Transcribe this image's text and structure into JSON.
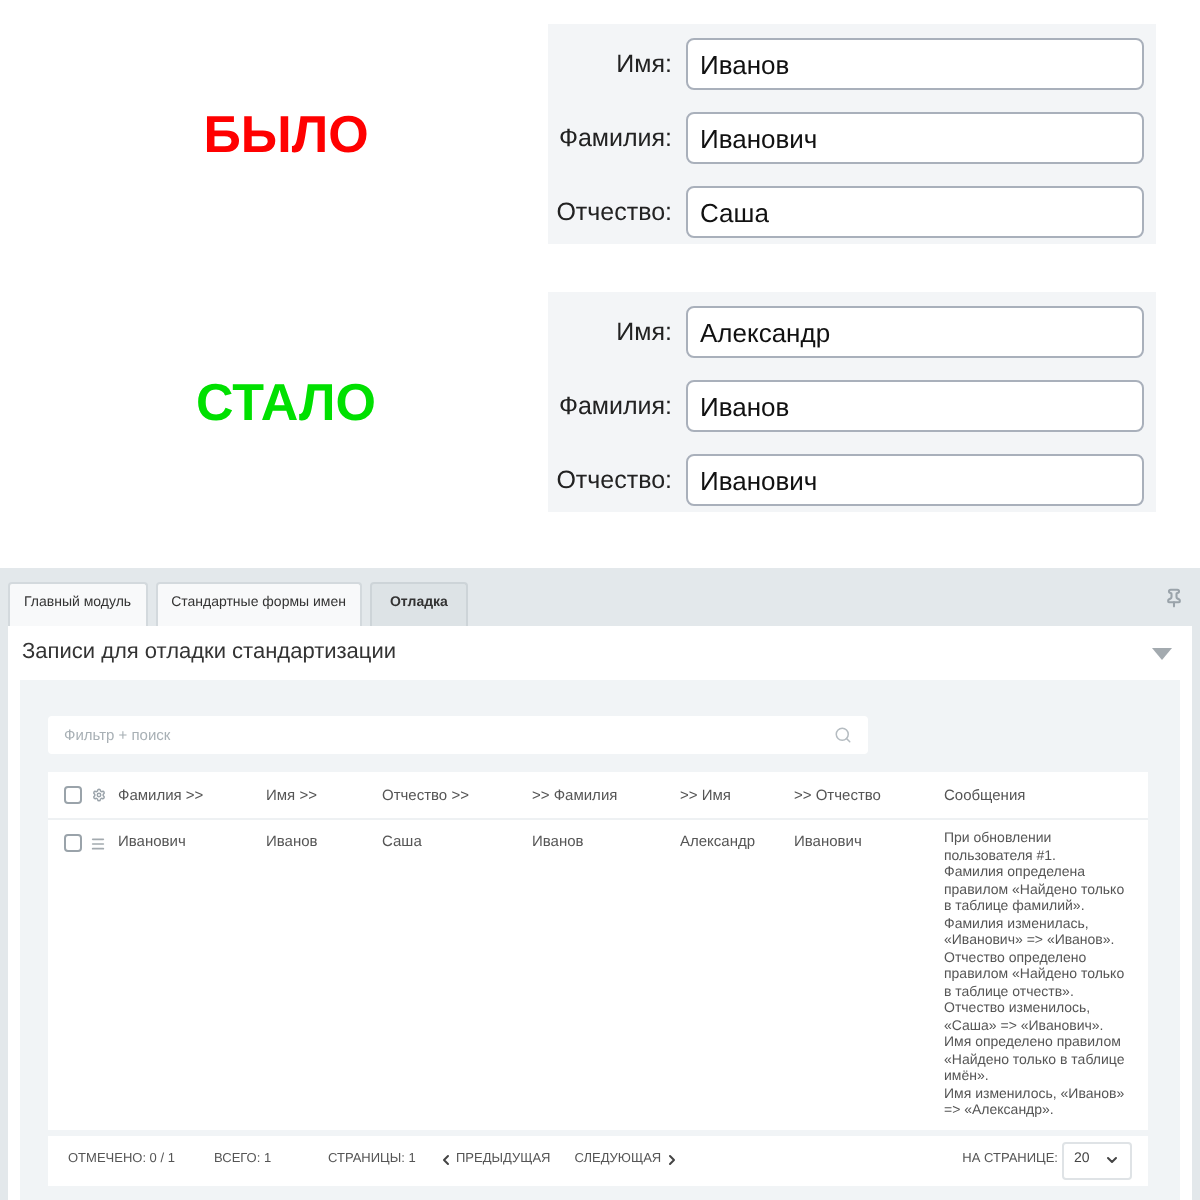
{
  "comparison": [
    {
      "caption": "БЫЛО",
      "color": "#ff0000",
      "fields": [
        {
          "label": "Имя:",
          "value": "Иванов"
        },
        {
          "label": "Фамилия:",
          "value": "Иванович"
        },
        {
          "label": "Отчество:",
          "value": "Саша"
        }
      ]
    },
    {
      "caption": "СТАЛО",
      "color": "#00e000",
      "fields": [
        {
          "label": "Имя:",
          "value": "Александр"
        },
        {
          "label": "Фамилия:",
          "value": "Иванов"
        },
        {
          "label": "Отчество:",
          "value": "Иванович"
        }
      ]
    }
  ],
  "tabs": [
    {
      "label": "Главный модуль",
      "selected": false
    },
    {
      "label": "Стандартные формы имен",
      "selected": false
    },
    {
      "label": "Отладка",
      "selected": true
    }
  ],
  "panel": {
    "title": "Записи для отладки стандартизации"
  },
  "filter": {
    "placeholder": "Фильтр + поиск"
  },
  "table": {
    "header_checkbox": {
      "checked": false
    },
    "columns": [
      "Фамилия >>",
      "Имя >>",
      "Отчество >>",
      ">> Фамилия",
      ">> Имя",
      ">> Отчество",
      "Сообщения"
    ],
    "rows": [
      {
        "checked": false,
        "cells": [
          "Иванович",
          "Иванов",
          "Саша",
          "Иванов",
          "Александр",
          "Иванович"
        ],
        "message": [
          "При обновлении пользователя #1.",
          "Фамилия определена правилом «Найдено только в таблице фамилий».",
          "Фамилия изменилась, «Иванович» => «Иванов».",
          "Отчество определено правилом «Найдено только в таблице отчеств».",
          "Отчество изменилось, «Саша» => «Иванович».",
          "Имя определено правилом «Найдено только в таблице имён».",
          "Имя изменилось, «Иванов» => «Александр»."
        ]
      }
    ]
  },
  "footer": {
    "selected_count": "ОТМЕЧЕНО: 0 / 1",
    "total": "ВСЕГО: 1",
    "pages": "СТРАНИЦЫ: 1",
    "previous": "ПРЕДЫДУЩАЯ",
    "next": "СЛЕДУЮЩАЯ",
    "per_page_label": "НА СТРАНИЦЕ:",
    "per_page": "20"
  }
}
